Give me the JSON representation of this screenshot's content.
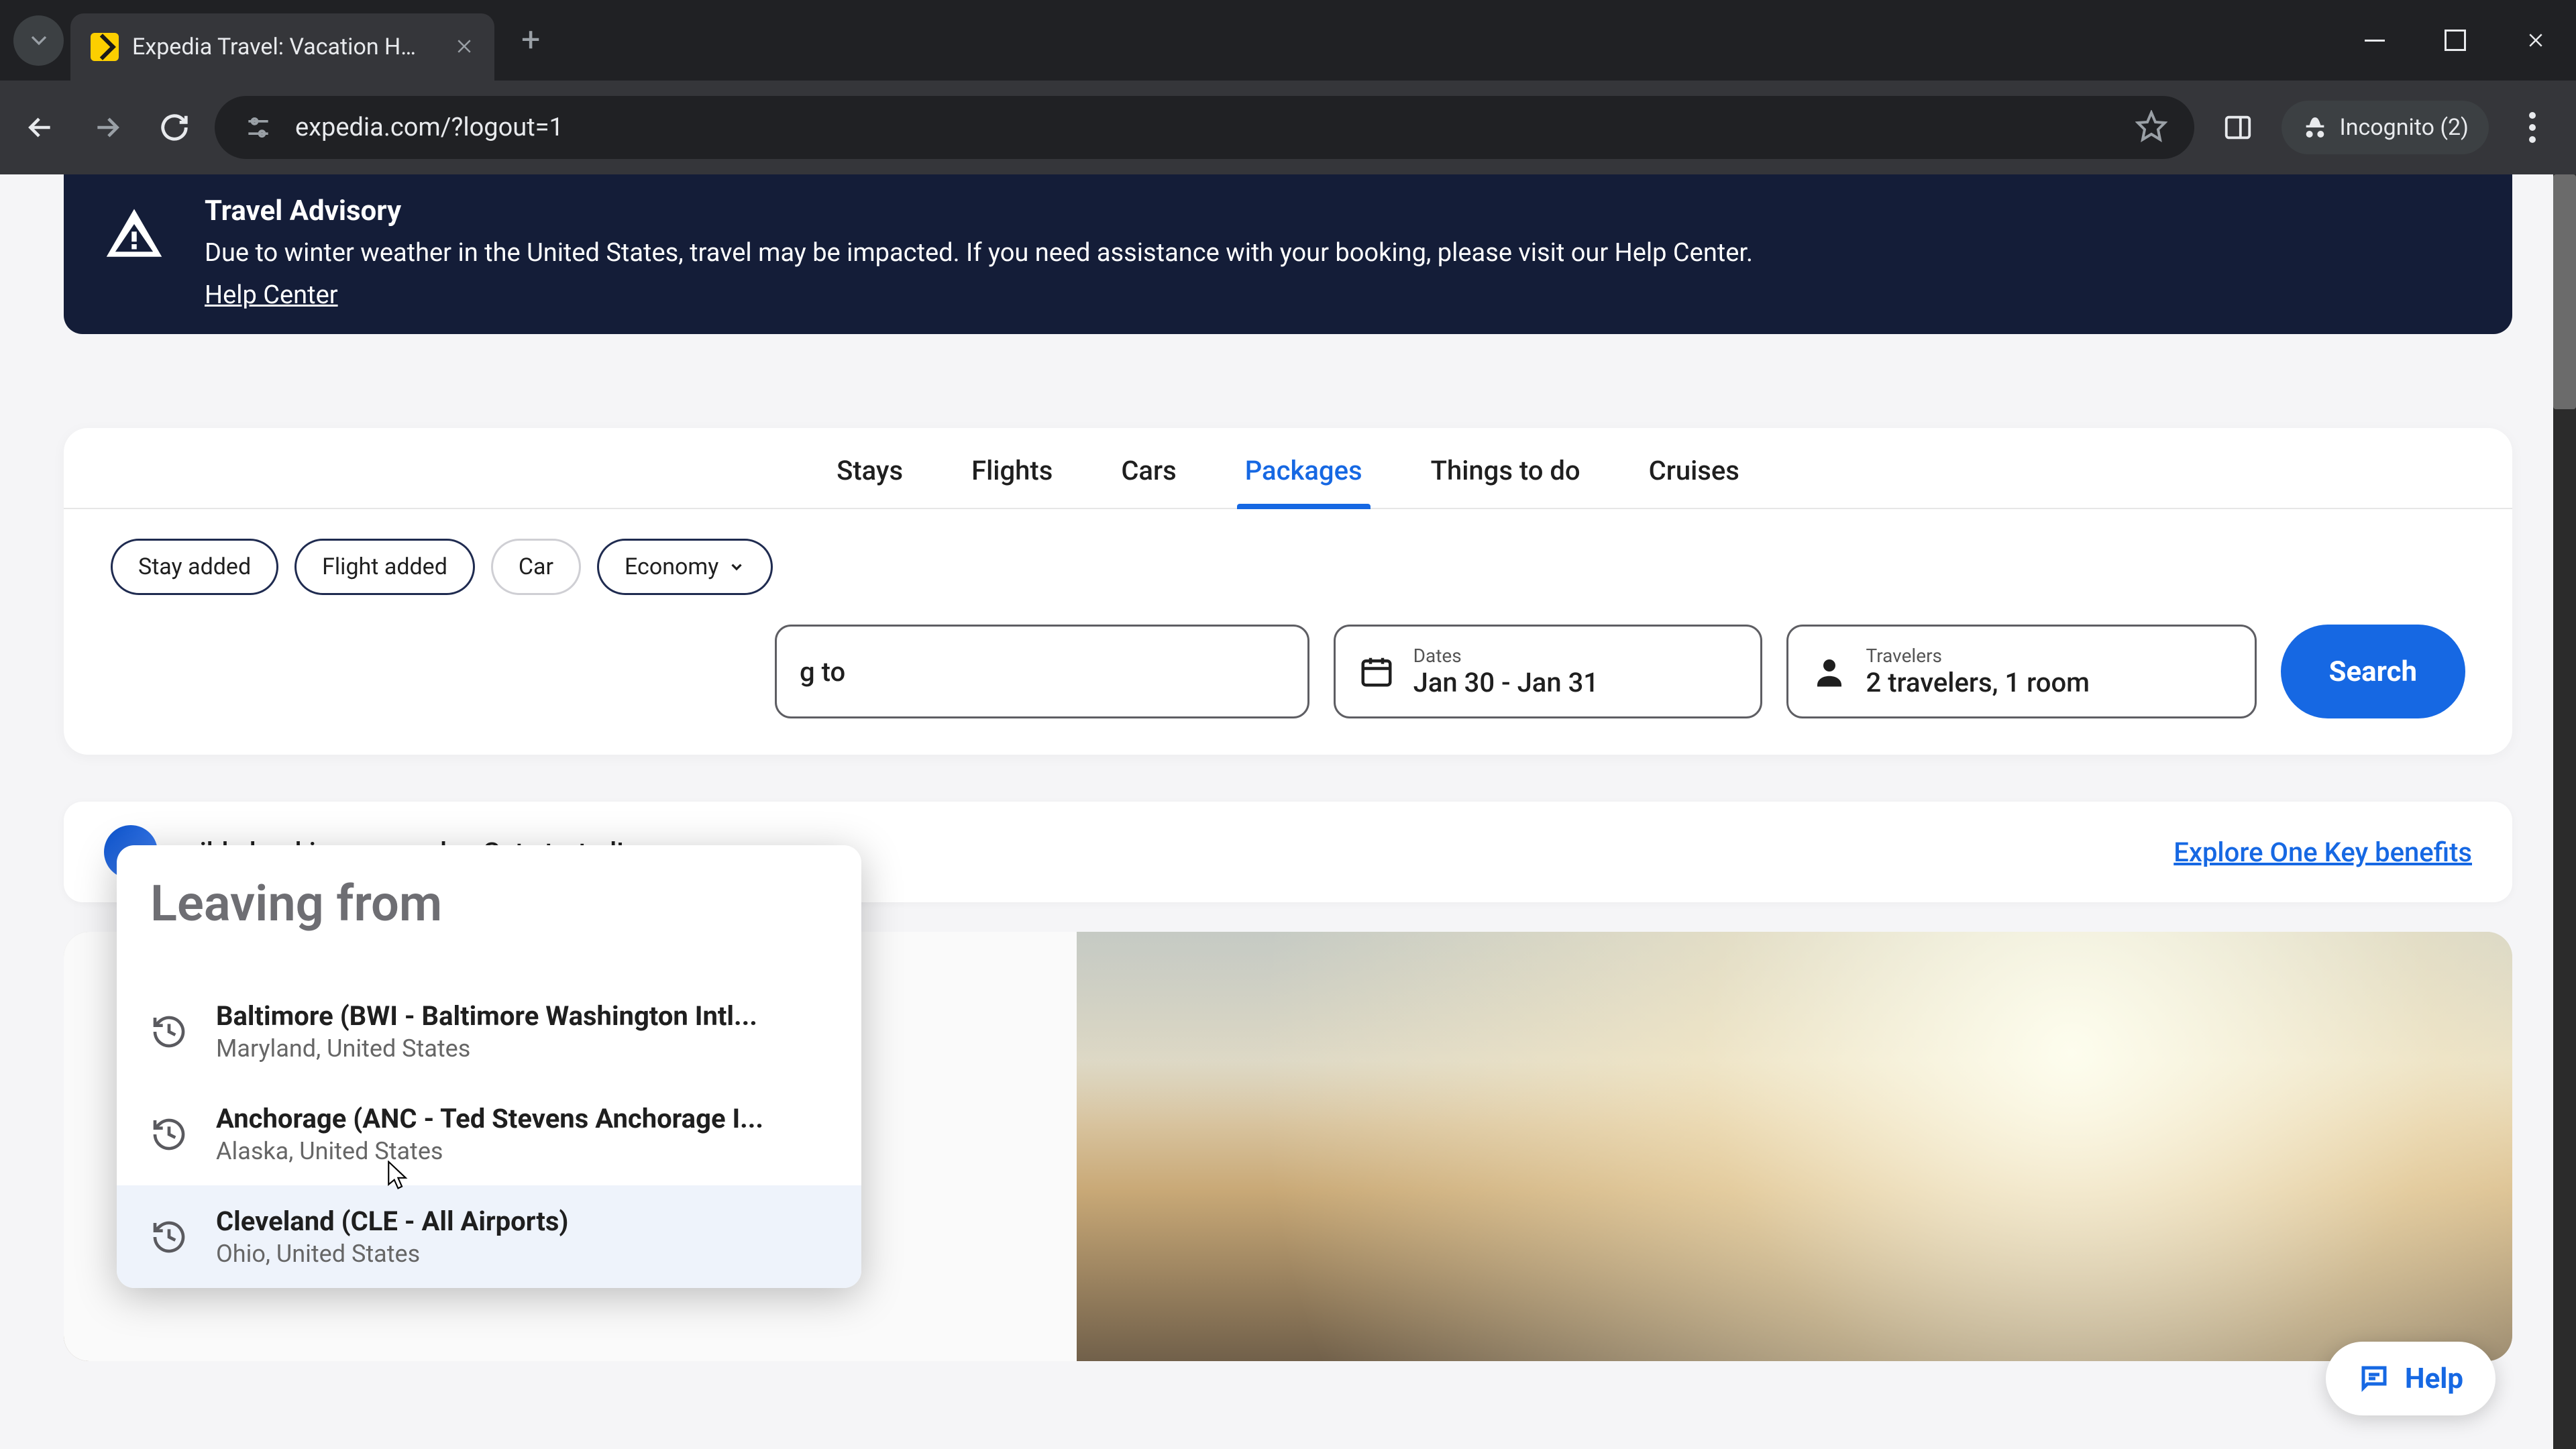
{
  "browser": {
    "tab_title": "Expedia Travel: Vacation Homes",
    "url": "expedia.com/?logout=1",
    "incognito_label": "Incognito (2)"
  },
  "advisory": {
    "heading": "Travel Advisory",
    "body": "Due to winter weather in the United States, travel may be impacted. If you need assistance with your booking, please visit our Help Center.",
    "link": "Help Center"
  },
  "lob_tabs": {
    "stays": "Stays",
    "flights": "Flights",
    "cars": "Cars",
    "packages": "Packages",
    "things": "Things to do",
    "cruises": "Cruises"
  },
  "pills": {
    "stay_added": "Stay added",
    "flight_added": "Flight added",
    "car": "Car",
    "economy": "Economy"
  },
  "fields": {
    "going_to_partial": "g to",
    "dates_label": "Dates",
    "dates_value": "Jan 30 - Jan 31",
    "travelers_label": "Travelers",
    "travelers_value": "2 travelers, 1 room"
  },
  "search_button": "Search",
  "leaving": {
    "placeholder": "Leaving from",
    "suggestions": [
      {
        "primary": "Baltimore (BWI - Baltimore Washington Intl...",
        "secondary": "Maryland, United States"
      },
      {
        "primary": "Anchorage (ANC - Ted Stevens Anchorage I...",
        "secondary": "Alaska, United States"
      },
      {
        "primary": "Cleveland (CLE - All Airports)",
        "secondary": "Ohio, United States"
      }
    ]
  },
  "onekey": {
    "partial_text": "gible booking you make. Get started!",
    "link": "Explore One Key benefits"
  },
  "help": {
    "label": "Help"
  }
}
